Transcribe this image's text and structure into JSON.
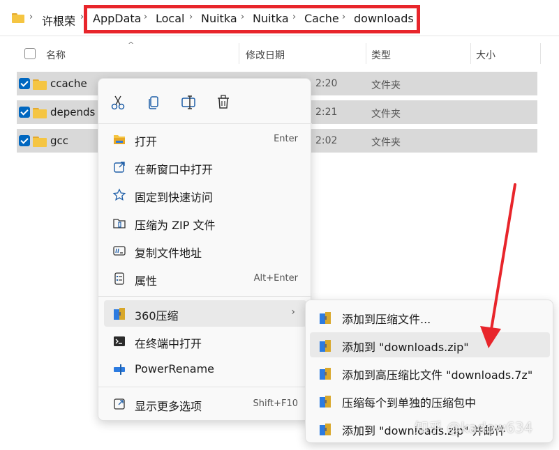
{
  "breadcrumb": {
    "items": [
      "许根荣",
      "AppData",
      "Local",
      "Nuitka",
      "Nuitka",
      "Cache",
      "downloads"
    ]
  },
  "columns": {
    "name": "名称",
    "modified": "修改日期",
    "type": "类型",
    "size": "大小"
  },
  "files": [
    {
      "name": "ccache",
      "date": "2:20",
      "type": "文件夹",
      "checked": true
    },
    {
      "name": "depends",
      "date": "2:21",
      "type": "文件夹",
      "checked": true
    },
    {
      "name": "gcc",
      "date": "2:02",
      "type": "文件夹",
      "checked": true
    }
  ],
  "context_menu": {
    "quick_actions": [
      "cut-icon",
      "copy-icon",
      "rename-icon",
      "delete-icon"
    ],
    "items": [
      {
        "label": "打开",
        "shortcut": "Enter",
        "icon": "folder-open-icon"
      },
      {
        "label": "在新窗口中打开",
        "shortcut": "",
        "icon": "new-window-icon"
      },
      {
        "label": "固定到快速访问",
        "shortcut": "",
        "icon": "star-icon"
      },
      {
        "label": "压缩为 ZIP 文件",
        "shortcut": "",
        "icon": "zip-icon"
      },
      {
        "label": "复制文件地址",
        "shortcut": "",
        "icon": "copy-path-icon"
      },
      {
        "label": "属性",
        "shortcut": "Alt+Enter",
        "icon": "properties-icon"
      },
      {
        "label": "360压缩",
        "shortcut": "",
        "icon": "archive-360-icon",
        "submenu": true
      },
      {
        "label": "在终端中打开",
        "shortcut": "",
        "icon": "terminal-icon"
      },
      {
        "label": "PowerRename",
        "shortcut": "",
        "icon": "powerrename-icon"
      },
      {
        "label": "显示更多选项",
        "shortcut": "Shift+F10",
        "icon": "more-options-icon"
      }
    ]
  },
  "submenu": {
    "items": [
      {
        "label": "添加到压缩文件..."
      },
      {
        "label": "添加到 \"downloads.zip\""
      },
      {
        "label": "添加到高压缩比文件 \"downloads.7z\""
      },
      {
        "label": "压缩每个到单独的压缩包中"
      },
      {
        "label": "添加到 \"downloads.zip\" 并邮件"
      }
    ]
  },
  "watermark": "知乎 @kadow634",
  "colors": {
    "highlight_box": "#e8252b",
    "arrow": "#e8252b",
    "checkbox": "#0067c0",
    "selected_row": "#d9d9d9",
    "folder": "#f5c542"
  }
}
